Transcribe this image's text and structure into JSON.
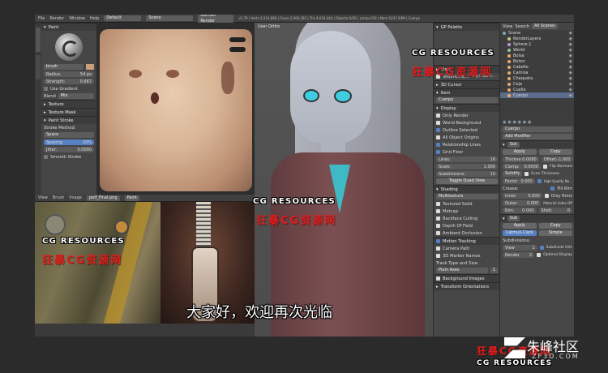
{
  "topbar": {
    "menus": [
      "File",
      "Render",
      "Window",
      "Help"
    ],
    "layout": "Default",
    "scene": "Scene",
    "engine": "Blender Render",
    "stats": "v2.79 | Verts:2,014,868 | Faces:2,909,282 | Tris:4,018,444 | Objects:0/26 | Lamps:0/0 | Mem:1037.93M | Cuerpo"
  },
  "paint_panel": {
    "title": "Paint",
    "brush": "brush",
    "radius_label": "Radius:",
    "radius_value": "54 px",
    "strength_label": "Strength:",
    "strength_value": "0.667",
    "use_gradient": "Use Gradient",
    "blend_label": "Blend",
    "blend_value": "Mix",
    "sections": [
      "Texture",
      "Texture Mask",
      "Paint Stroke"
    ],
    "stroke_method_label": "Stroke Method:",
    "stroke_method_value": "Space",
    "spacing_label": "Spacing",
    "spacing_value": "10%",
    "jitter_label": "Jitter:",
    "jitter_value": "0.0000",
    "smooth_stroke": "Smooth Stroke"
  },
  "image_editor_bottom": {
    "menus": [
      "View",
      "Brush",
      "Image"
    ],
    "image_name": "pelf_Final.png",
    "mode": "Paint"
  },
  "viewport": {
    "label": "User Ortho"
  },
  "gp_panel": {
    "title": "GP Palette",
    "view_label": "View",
    "lens_label": "Lens",
    "volumetric_label": "Volumetric...",
    "high_quality": "High Qualit...",
    "cursor_label": "3D Cursor",
    "item_label": "Item",
    "item_name": "Cuerpo",
    "display_label": "Display",
    "only_render": "Only Render",
    "world_background": "World Background",
    "outline_selected": "Outline Selected",
    "all_object_origins": "All Object Origins",
    "relationship_lines": "Relationship Lines",
    "grid_floor": "Grid Floor",
    "lines_label": "Lines:",
    "lines_value": "16",
    "scale_label": "Scale:",
    "scale_value": "1.000",
    "subdivisions_label": "Subdivisions:",
    "subdivisions_value": "10",
    "toggle_quad_view": "Toggle Quad View",
    "shading_label": "Shading",
    "shading_value": "Multitexture",
    "textured_solid": "Textured Solid",
    "matcap": "Matcap",
    "backface_culling": "Backface Culling",
    "depth_of_field": "Depth Of Field",
    "ambient_occlusion": "Ambient Occlusion",
    "motion_tracking": "Motion Tracking",
    "camera_path": "Camera Path",
    "marker_names": "3D Marker Names",
    "track_type": "Track Type and Size:",
    "plain_axes": "Plain Axes",
    "plain_axes_val": "1",
    "background_images": "Background Images",
    "transform_orientations": "Transform Orientations"
  },
  "outliner": {
    "view": "View",
    "search": "Search",
    "filter": "All Scenes",
    "items": [
      "Scene",
      "RenderLayers",
      "Sphere.1",
      "World",
      "Bolsa",
      "Boton",
      "Cabello",
      "Camisa",
      "Chaqueta",
      "Ceja",
      "Cuello",
      "Cuerpo"
    ]
  },
  "properties": {
    "object_name": "Cuerpo",
    "add_modifier": "Add Modifier",
    "modifier1": "Soli",
    "apply": "Apply",
    "copy": "Copy",
    "thickness_label": "Thickne:",
    "thickness_value": "0.0080",
    "offset_label": "Offset:",
    "offset_value": "-1.000",
    "clamp_label": "Clamp:",
    "clamp_value": "0.0000",
    "flip_normals": "Flip Normals",
    "solidify_label": "Solidify",
    "even_thickness": "Even Thickness",
    "factor_label": "Factor",
    "factor_value": "0.000",
    "high_quality_normals": "High Quality No...",
    "fill_rim": "Fill Rim",
    "crease_label": "Crease:",
    "only_rim": "Only Rims",
    "inner_label": "Inner:",
    "inner_value": "0.000",
    "outer_label": "Outer:",
    "outer_value": "0.000",
    "rim_label": "Rim:",
    "rim_value": "0.000",
    "material_index": "Material Index Off",
    "shell_label": "Shell:",
    "shell_value": "0",
    "modifier2": "Sub",
    "catmull_clark": "Catmull-Clark",
    "simple": "Simple",
    "subdivisions": "Subdivisions:",
    "view_label": "View",
    "view_value": "1",
    "render_label": "Render",
    "render_value": "2",
    "subdivide_uvs": "Subdivide UVs",
    "optimal_display": "Optimal Display"
  },
  "watermarks": {
    "en": "CG RESOURCES",
    "cn": "狂暴CG资源网"
  },
  "logo": {
    "cn": "朱峰社区",
    "url": "ZF3D.COM"
  },
  "subtitle": "大家好，欢迎再次光临"
}
